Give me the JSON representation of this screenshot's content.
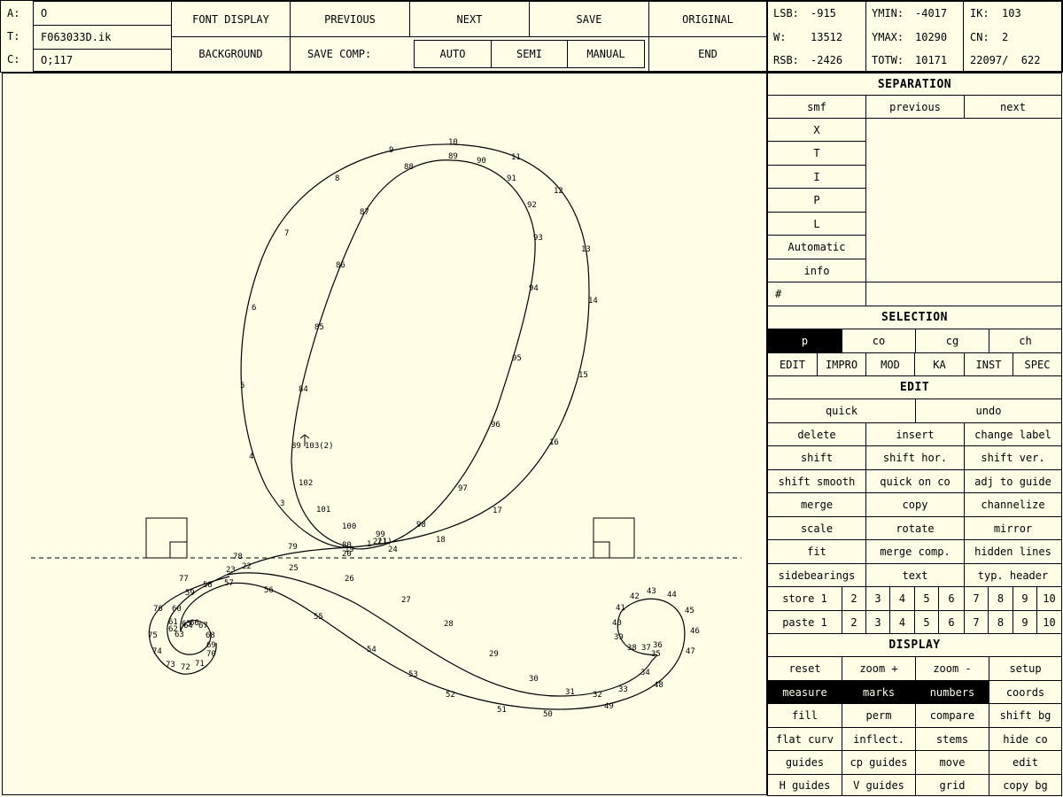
{
  "header": {
    "labels": {
      "a": "A:",
      "t": "T:",
      "c": "C:"
    },
    "a_value": "O",
    "t_value": "F063033D.ik",
    "c_value": "O;117",
    "buttons": {
      "font_display": "FONT DISPLAY",
      "previous": "PREVIOUS",
      "next": "NEXT",
      "save": "SAVE",
      "original": "ORIGINAL",
      "background": "BACKGROUND",
      "end": "END"
    },
    "save_comp_label": "SAVE COMP:",
    "save_comp_modes": [
      "AUTO",
      "SEMI",
      "MANUAL"
    ]
  },
  "metrics": {
    "lsb_label": "LSB:",
    "lsb": "-915",
    "w_label": "W:",
    "w": "13512",
    "rsb_label": "RSB:",
    "rsb": "-2426",
    "ymin_label": "YMIN:",
    "ymin": "-4017",
    "ymax_label": "YMAX:",
    "ymax": "10290",
    "totw_label": "TOTW:",
    "totw": "10171",
    "ik_label": "IK:",
    "ik": "103",
    "cn_label": "CN:",
    "cn": "2",
    "coords": "22097/  622"
  },
  "separation": {
    "title": "SEPARATION",
    "nav": [
      "smf",
      "previous",
      "next"
    ],
    "tools": [
      "X",
      "T",
      "I",
      "P",
      "L",
      "Automatic",
      "info"
    ],
    "hash": "#"
  },
  "selection": {
    "title": "SELECTION",
    "row1": [
      "p",
      "co",
      "cg",
      "ch"
    ],
    "row2": [
      "EDIT",
      "IMPRO",
      "MOD",
      "KA",
      "INST",
      "SPEC"
    ]
  },
  "edit": {
    "title": "EDIT",
    "quick": "quick",
    "undo": "undo",
    "grid": [
      [
        "delete",
        "insert",
        "change label"
      ],
      [
        "shift",
        "shift hor.",
        "shift ver."
      ],
      [
        "shift smooth",
        "quick on co",
        "adj to guide"
      ],
      [
        "merge",
        "copy",
        "channelize"
      ],
      [
        "scale",
        "rotate",
        "mirror"
      ],
      [
        "fit",
        "merge comp.",
        "hidden lines"
      ],
      [
        "sidebearings",
        "text",
        "typ. header"
      ]
    ],
    "store": [
      "store 1",
      "2",
      "3",
      "4",
      "5",
      "6",
      "7",
      "8",
      "9",
      "10"
    ],
    "paste": [
      "paste 1",
      "2",
      "3",
      "4",
      "5",
      "6",
      "7",
      "8",
      "9",
      "10"
    ]
  },
  "display": {
    "title": "DISPLAY",
    "rows": [
      [
        "reset",
        "zoom +",
        "zoom -",
        "setup"
      ],
      [
        "measure",
        "marks",
        "numbers",
        "coords"
      ],
      [
        "fill",
        "perm",
        "compare",
        "shift bg"
      ],
      [
        "flat curv",
        "inflect.",
        "stems",
        "hide co"
      ],
      [
        "guides",
        "cp guides",
        "move",
        "edit"
      ],
      [
        "H guides",
        "V guides",
        "grid",
        "copy bg"
      ]
    ]
  },
  "canvas": {
    "point_labels": [
      "9",
      "10",
      "11",
      "12",
      "13",
      "14",
      "15",
      "16",
      "17",
      "18",
      "19",
      "20",
      "21",
      "22",
      "23",
      "24",
      "25",
      "26",
      "27",
      "28",
      "29",
      "30",
      "31",
      "32",
      "33",
      "34",
      "35",
      "36",
      "37",
      "38",
      "39",
      "40",
      "41",
      "42",
      "43",
      "44",
      "45",
      "46",
      "47",
      "48",
      "49",
      "50",
      "51",
      "52",
      "53",
      "54",
      "55",
      "56",
      "57",
      "58",
      "59",
      "60",
      "61",
      "62",
      "63",
      "64",
      "65",
      "66",
      "67",
      "68",
      "69",
      "70",
      "71",
      "72",
      "73",
      "74",
      "75",
      "76",
      "77",
      "78",
      "79",
      "80",
      "81",
      "82",
      "83",
      "84",
      "85",
      "86",
      "87",
      "88",
      "89",
      "90",
      "91",
      "92",
      "93",
      "94",
      "95",
      "96",
      "97",
      "98",
      "99",
      "100",
      "101",
      "102",
      "103(2)",
      "2(1)",
      "8",
      "7",
      "6",
      "5",
      "4",
      "3",
      "1"
    ]
  }
}
